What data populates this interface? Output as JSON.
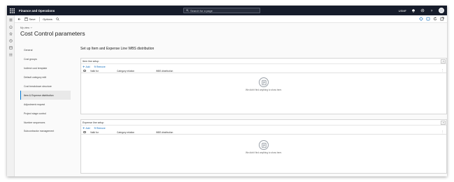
{
  "topbar": {
    "app_name": "Finance and Operations",
    "search_placeholder": "Search for a page",
    "company": "USMF"
  },
  "actionbar": {
    "save": "Save",
    "options": "Options"
  },
  "breadcrumb": "My view",
  "page_title": "Cost Control parameters",
  "tabs": [
    "General",
    "Cost groups",
    "Indirect cost template",
    "Default category edit",
    "Cost breakdown structure",
    "Item & Expense distribution",
    "Adjustment request",
    "Project stage control",
    "Number sequences",
    "Subcontractor management"
  ],
  "active_tab_index": 5,
  "content": {
    "title": "Set up Item and Expense Line WBS distribution",
    "sections": [
      {
        "header": "Item line setup",
        "add": "Add",
        "remove": "Remove",
        "columns": [
          "Valid for",
          "Category relation",
          "WBS distribution"
        ],
        "empty_text": "We didn't find anything to show here."
      },
      {
        "header": "Expense line setup",
        "add": "Add",
        "remove": "Remove",
        "columns": [
          "Valid for",
          "Category relation",
          "WBS distribution"
        ],
        "empty_text": "We didn't find anything to show here."
      }
    ]
  },
  "colors": {
    "topbar": "#161c2b",
    "accent": "#0f6cbd",
    "active_tab_bar": "#0078d4"
  }
}
